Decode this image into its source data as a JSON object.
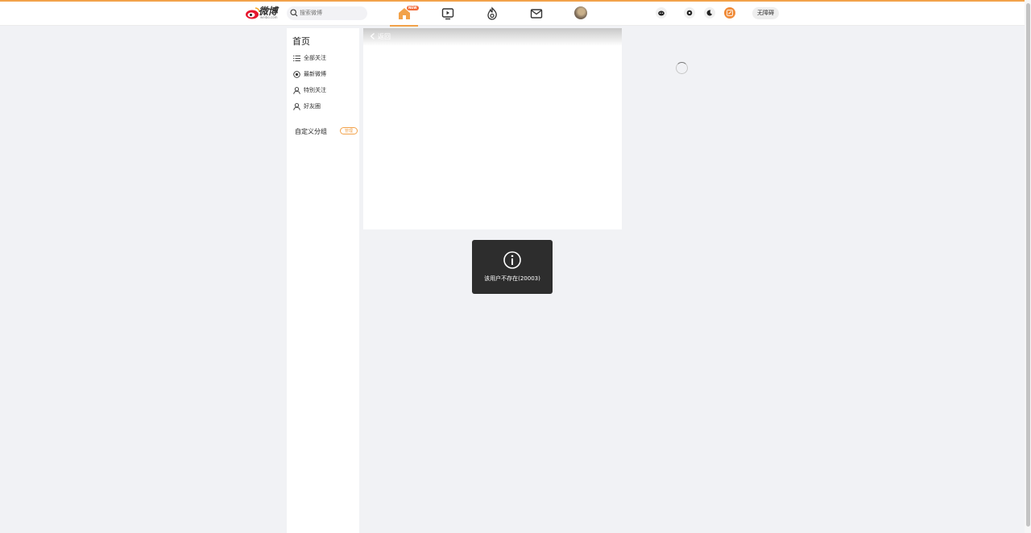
{
  "header": {
    "logo_text": "微博",
    "logo_sub": "weibo.com",
    "search_placeholder": "搜索微博",
    "new_badge": "NEW",
    "nav_icons": [
      "home-icon",
      "video-icon",
      "hot-icon",
      "message-icon"
    ],
    "right_icons": [
      "game-icon",
      "settings-icon",
      "moon-icon",
      "edit-icon"
    ],
    "accessibility_label": "无障碍"
  },
  "sidebar": {
    "title": "首页",
    "items": [
      {
        "label": "全部关注",
        "icon": "list-icon"
      },
      {
        "label": "最新微博",
        "icon": "latest-icon"
      },
      {
        "label": "特别关注",
        "icon": "user-icon"
      },
      {
        "label": "好友圈",
        "icon": "user-icon"
      }
    ],
    "group_label": "自定义分组",
    "manage_label": "管理"
  },
  "main": {
    "back_label": "返回"
  },
  "toast": {
    "message": "该用户不存在(20003)",
    "icon": "info-icon"
  },
  "colors": {
    "accent": "#f2a24a",
    "toast_bg": "#2d2d2d",
    "page_bg": "#f1f2f5"
  }
}
